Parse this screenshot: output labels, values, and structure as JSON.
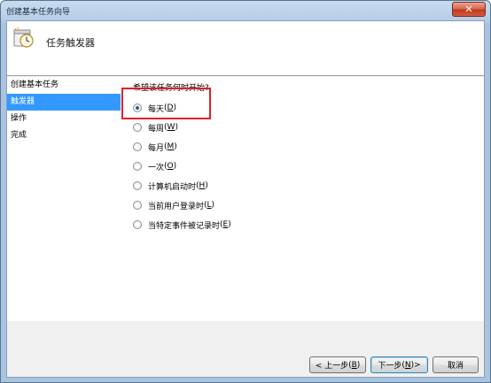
{
  "window": {
    "title": "创建基本任务向导",
    "close_symbol": "✕"
  },
  "header": {
    "title": "任务触发器",
    "icon": "clock-task-icon"
  },
  "sidebar": {
    "items": [
      {
        "label": "创建基本任务",
        "selected": false
      },
      {
        "label": "触发器",
        "selected": true
      },
      {
        "label": "操作",
        "selected": false
      },
      {
        "label": "完成",
        "selected": false
      }
    ]
  },
  "main": {
    "question": "希望该任务何时开始?",
    "options": [
      {
        "label": "每天",
        "key": "D",
        "checked": true
      },
      {
        "label": "每周",
        "key": "W",
        "checked": false
      },
      {
        "label": "每月",
        "key": "M",
        "checked": false
      },
      {
        "label": "一次",
        "key": "O",
        "checked": false
      },
      {
        "label": "计算机启动时",
        "key": "H",
        "checked": false
      },
      {
        "label": "当前用户登录时",
        "key": "L",
        "checked": false
      },
      {
        "label": "当特定事件被记录时",
        "key": "E",
        "checked": false
      }
    ]
  },
  "footer": {
    "back": {
      "label": "< 上一步",
      "key": "B"
    },
    "next": {
      "label": "下一步",
      "key": "N",
      "suffix": " >"
    },
    "cancel": {
      "label": "取消"
    }
  },
  "colors": {
    "selection": "#3399ff",
    "highlight_box": "#e0202a"
  }
}
